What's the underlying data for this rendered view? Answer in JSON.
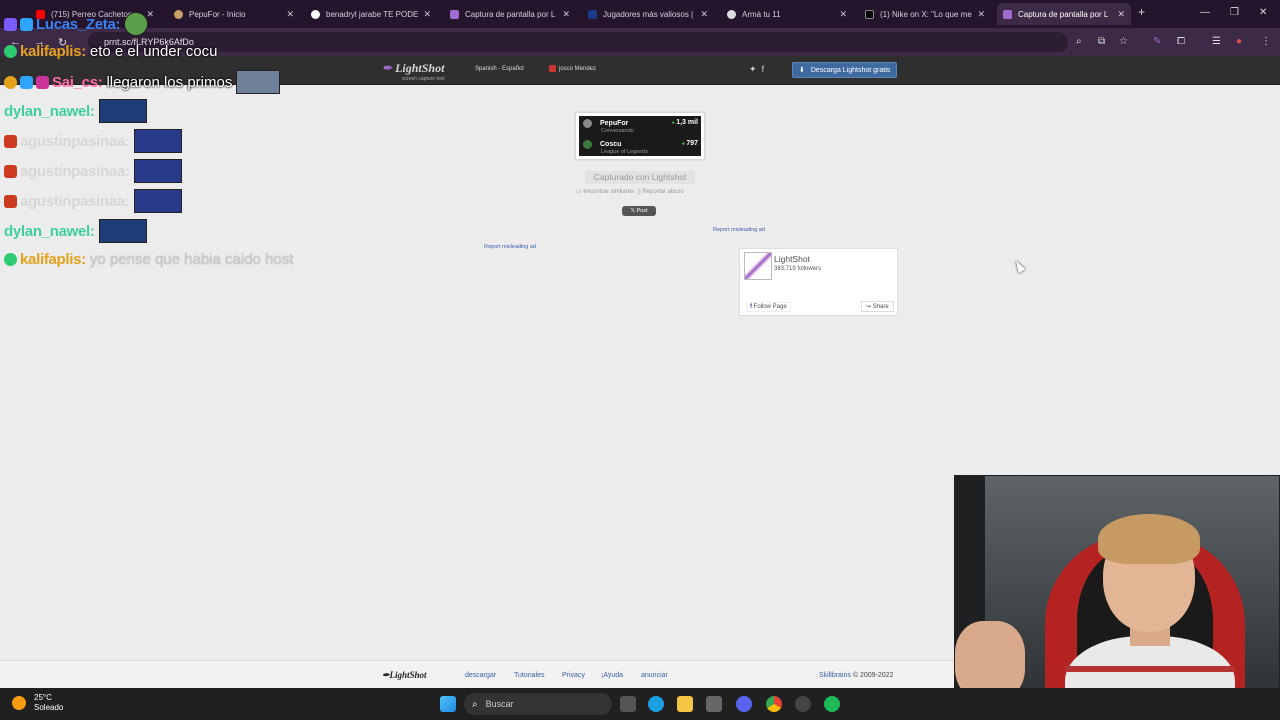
{
  "browser": {
    "tabs": [
      {
        "title": "(715) Perreo Cacheton",
        "favicon_color": "#ff0000",
        "active": false
      },
      {
        "title": "PepuFor - Inicio",
        "favicon_color": "#c7a06a",
        "active": false
      },
      {
        "title": "benadryl jarabe TE PODE",
        "favicon_color": "#ffffff",
        "active": false
      },
      {
        "title": "Captura de pantalla por L",
        "favicon_color": "#a06ccf",
        "active": false
      },
      {
        "title": "Jugadores más valiosos |",
        "favicon_color": "#1b3a8a",
        "active": false
      },
      {
        "title": "Armá tu 11",
        "favicon_color": "#dddddd",
        "active": false
      },
      {
        "title": "(1) Nike on X: \"Lo que me",
        "favicon_color": "#000000",
        "active": false
      },
      {
        "title": "Captura de pantalla por L",
        "favicon_color": "#a06ccf",
        "active": true
      }
    ],
    "new_tab": "+",
    "url": "prnt.sc/fLRYP6k6AfDo",
    "window_controls": [
      "—",
      "❐",
      "✕"
    ]
  },
  "chat": [
    {
      "user": "Lucas_Zeta:",
      "user_color": "#3b82f6",
      "message": "",
      "faded": false
    },
    {
      "user": "kalifaplis:",
      "user_color": "#e3a21a",
      "message": "eto e el under cocu",
      "faded": false
    },
    {
      "user": "Sai_cs:",
      "user_color": "#ff6aa6",
      "message": "llegaron los primos",
      "faded": false
    },
    {
      "user": "dylan_nawel:",
      "user_color": "#3ecfa0",
      "message": "",
      "faded": true
    },
    {
      "user": "agustinpasinaa:",
      "user_color": "#d7d7d7",
      "message": "",
      "faded": true
    },
    {
      "user": "agustinpasinaa:",
      "user_color": "#d7d7d7",
      "message": "",
      "faded": true
    },
    {
      "user": "agustinpasinaa:",
      "user_color": "#d7d7d7",
      "message": "",
      "faded": true
    },
    {
      "user": "dylan_nawel:",
      "user_color": "#3ecfa0",
      "message": "",
      "faded": true
    },
    {
      "user": "kalifaplis:",
      "user_color": "#e3a21a",
      "message": "yo pense que habia caido host",
      "faded": true
    }
  ],
  "lightshot_header": {
    "logo": "LightShot",
    "logo_sub": "screen capture tool",
    "language": "Spanish - Español",
    "user": "josco Mendez",
    "download": "Descarga Lightshot gratis"
  },
  "preview": {
    "rows": [
      {
        "name": "PepuFor",
        "sub": "Conversando",
        "count": "1,3 mil",
        "avatar_color": "#888888"
      },
      {
        "name": "Coscu",
        "sub": "League of Legends",
        "count": "797",
        "avatar_color": "#3d7a3d"
      }
    ]
  },
  "capture": {
    "captured": "Capturado con Lightshot",
    "similar": "encontrar similares",
    "report_abuse": "Reportar abuso",
    "post": "Post"
  },
  "ads": {
    "report_left": "Report misleading ad",
    "report_right": "Report misleading ad"
  },
  "facebook": {
    "name": "LightShot",
    "followers": "383,719 followers",
    "follow": "Follow Page",
    "share": "Share"
  },
  "footer": {
    "logo": "LightShot",
    "links": [
      "descargar",
      "Tutoriales",
      "Privacy",
      "¡Ayuda",
      "anunciar"
    ],
    "brand": "Skillbrains",
    "copyright": "© 2009-2022"
  },
  "taskbar": {
    "temp": "25°C",
    "weather": "Soleado",
    "search": "Buscar"
  }
}
